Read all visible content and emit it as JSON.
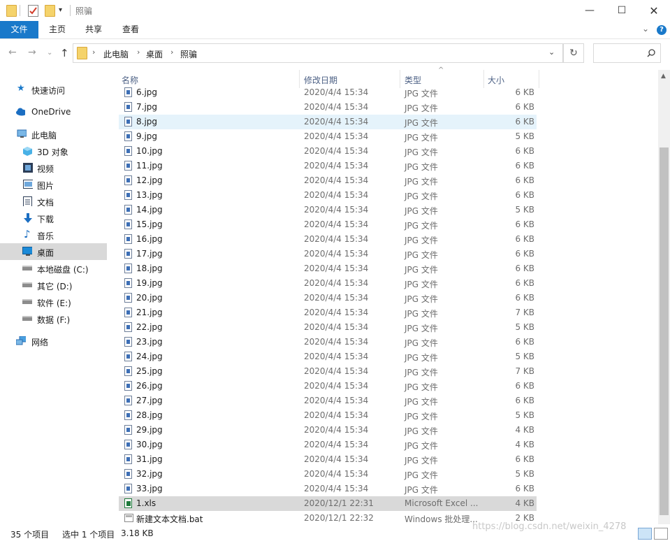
{
  "window": {
    "title": "照骗"
  },
  "ribbon": {
    "tabs": [
      "文件",
      "主页",
      "共享",
      "查看"
    ]
  },
  "breadcrumb": [
    "此电脑",
    "桌面",
    "照骗"
  ],
  "search": {
    "placeholder": ""
  },
  "sidebar": {
    "items": [
      {
        "label": "快速访问",
        "icon": "star-icon"
      },
      {
        "label": "OneDrive",
        "icon": "cloud-icon"
      },
      {
        "label": "此电脑",
        "icon": "computer-icon"
      },
      {
        "label": "3D 对象",
        "icon": "cube-icon"
      },
      {
        "label": "视频",
        "icon": "video-icon"
      },
      {
        "label": "图片",
        "icon": "picture-icon"
      },
      {
        "label": "文档",
        "icon": "document-icon"
      },
      {
        "label": "下载",
        "icon": "download-icon"
      },
      {
        "label": "音乐",
        "icon": "music-icon"
      },
      {
        "label": "桌面",
        "icon": "desktop-icon"
      },
      {
        "label": "本地磁盘 (C:)",
        "icon": "drive-icon"
      },
      {
        "label": "其它 (D:)",
        "icon": "drive-icon"
      },
      {
        "label": "软件 (E:)",
        "icon": "drive-icon"
      },
      {
        "label": "数据 (F:)",
        "icon": "drive-icon"
      },
      {
        "label": "网络",
        "icon": "network-icon"
      }
    ]
  },
  "columns": [
    "名称",
    "修改日期",
    "类型",
    "大小"
  ],
  "files": [
    {
      "name": "6.jpg",
      "date": "2020/4/4 15:34",
      "type": "JPG 文件",
      "size": "6 KB"
    },
    {
      "name": "7.jpg",
      "date": "2020/4/4 15:34",
      "type": "JPG 文件",
      "size": "6 KB"
    },
    {
      "name": "8.jpg",
      "date": "2020/4/4 15:34",
      "type": "JPG 文件",
      "size": "6 KB"
    },
    {
      "name": "9.jpg",
      "date": "2020/4/4 15:34",
      "type": "JPG 文件",
      "size": "5 KB"
    },
    {
      "name": "10.jpg",
      "date": "2020/4/4 15:34",
      "type": "JPG 文件",
      "size": "6 KB"
    },
    {
      "name": "11.jpg",
      "date": "2020/4/4 15:34",
      "type": "JPG 文件",
      "size": "6 KB"
    },
    {
      "name": "12.jpg",
      "date": "2020/4/4 15:34",
      "type": "JPG 文件",
      "size": "6 KB"
    },
    {
      "name": "13.jpg",
      "date": "2020/4/4 15:34",
      "type": "JPG 文件",
      "size": "6 KB"
    },
    {
      "name": "14.jpg",
      "date": "2020/4/4 15:34",
      "type": "JPG 文件",
      "size": "5 KB"
    },
    {
      "name": "15.jpg",
      "date": "2020/4/4 15:34",
      "type": "JPG 文件",
      "size": "6 KB"
    },
    {
      "name": "16.jpg",
      "date": "2020/4/4 15:34",
      "type": "JPG 文件",
      "size": "6 KB"
    },
    {
      "name": "17.jpg",
      "date": "2020/4/4 15:34",
      "type": "JPG 文件",
      "size": "6 KB"
    },
    {
      "name": "18.jpg",
      "date": "2020/4/4 15:34",
      "type": "JPG 文件",
      "size": "6 KB"
    },
    {
      "name": "19.jpg",
      "date": "2020/4/4 15:34",
      "type": "JPG 文件",
      "size": "6 KB"
    },
    {
      "name": "20.jpg",
      "date": "2020/4/4 15:34",
      "type": "JPG 文件",
      "size": "6 KB"
    },
    {
      "name": "21.jpg",
      "date": "2020/4/4 15:34",
      "type": "JPG 文件",
      "size": "7 KB"
    },
    {
      "name": "22.jpg",
      "date": "2020/4/4 15:34",
      "type": "JPG 文件",
      "size": "5 KB"
    },
    {
      "name": "23.jpg",
      "date": "2020/4/4 15:34",
      "type": "JPG 文件",
      "size": "6 KB"
    },
    {
      "name": "24.jpg",
      "date": "2020/4/4 15:34",
      "type": "JPG 文件",
      "size": "5 KB"
    },
    {
      "name": "25.jpg",
      "date": "2020/4/4 15:34",
      "type": "JPG 文件",
      "size": "7 KB"
    },
    {
      "name": "26.jpg",
      "date": "2020/4/4 15:34",
      "type": "JPG 文件",
      "size": "6 KB"
    },
    {
      "name": "27.jpg",
      "date": "2020/4/4 15:34",
      "type": "JPG 文件",
      "size": "6 KB"
    },
    {
      "name": "28.jpg",
      "date": "2020/4/4 15:34",
      "type": "JPG 文件",
      "size": "5 KB"
    },
    {
      "name": "29.jpg",
      "date": "2020/4/4 15:34",
      "type": "JPG 文件",
      "size": "4 KB"
    },
    {
      "name": "30.jpg",
      "date": "2020/4/4 15:34",
      "type": "JPG 文件",
      "size": "4 KB"
    },
    {
      "name": "31.jpg",
      "date": "2020/4/4 15:34",
      "type": "JPG 文件",
      "size": "6 KB"
    },
    {
      "name": "32.jpg",
      "date": "2020/4/4 15:34",
      "type": "JPG 文件",
      "size": "5 KB"
    },
    {
      "name": "33.jpg",
      "date": "2020/4/4 15:34",
      "type": "JPG 文件",
      "size": "6 KB"
    },
    {
      "name": "1.xls",
      "date": "2020/12/1 22:31",
      "type": "Microsoft Excel ...",
      "size": "4 KB"
    },
    {
      "name": "新建文本文档.bat",
      "date": "2020/12/1 22:32",
      "type": "Windows 批处理...",
      "size": "2 KB"
    }
  ],
  "status": {
    "count": "35 个项目",
    "selected": "选中 1 个项目",
    "selected_size": "3.18 KB"
  },
  "watermark": "https://blog.csdn.net/weixin_4278",
  "colors": {
    "accent": "#1979ca",
    "hover": "#e5f3fb",
    "selected": "#d9d9d9"
  }
}
